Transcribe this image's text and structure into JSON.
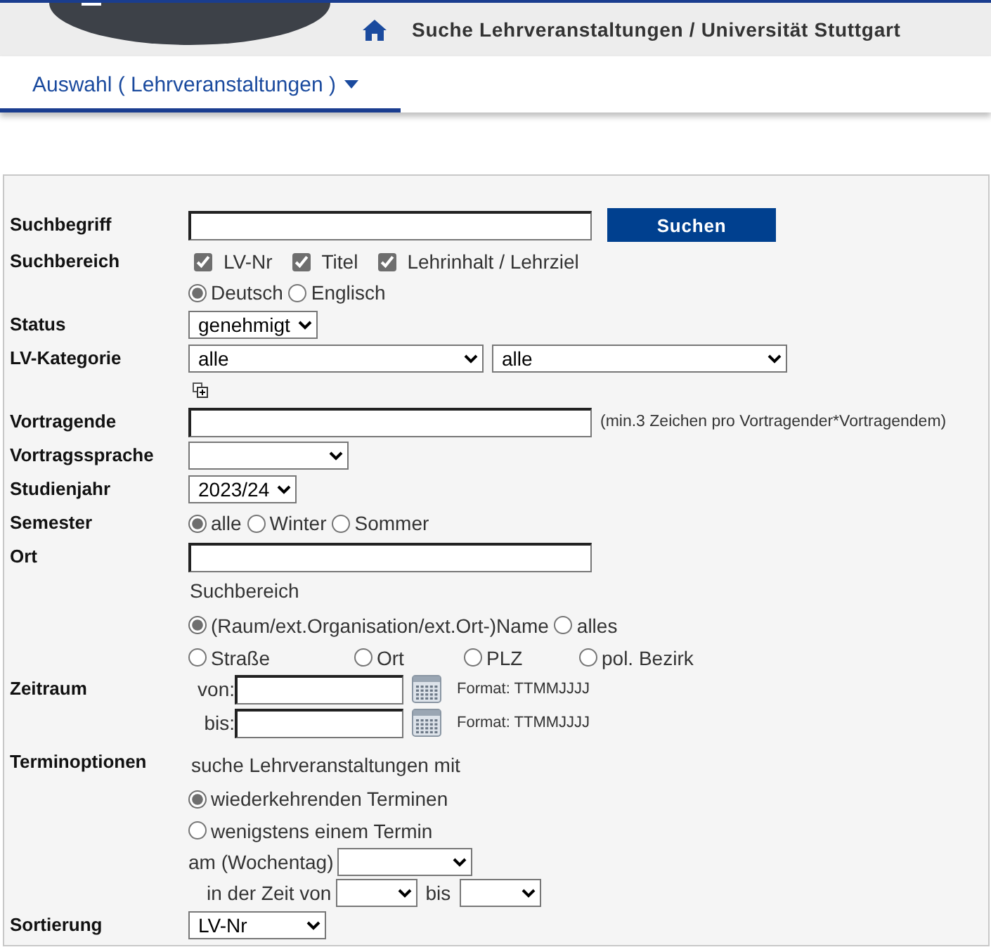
{
  "header": {
    "title": "Suche Lehrveranstaltungen / Universität Stuttgart"
  },
  "tabs": [
    {
      "label": "Auswahl ( Lehrveranstaltungen )",
      "selected": true
    }
  ],
  "form": [
    {
      "kind": "text",
      "label": "Suchbegriff",
      "button": "Suchen"
    },
    {
      "kind": "checks",
      "label": "Suchbereich",
      "checks": [
        {
          "label": "LV-Nr",
          "checked": true
        },
        {
          "label": "Titel",
          "checked": true
        },
        {
          "label": "Lehrinhalt / Lehrziel",
          "checked": true
        }
      ],
      "options": [
        {
          "label": "Deutsch",
          "selected": true
        },
        {
          "label": "Englisch",
          "selected": false
        }
      ]
    },
    {
      "kind": "select",
      "label": "Status",
      "value": "genehmigt"
    },
    {
      "kind": "selects",
      "label": "LV-Kategorie",
      "values": [
        "alle",
        "alle"
      ]
    },
    {
      "kind": "text",
      "label": "Vortragende",
      "hint": "(min.3 Zeichen pro Vortragender*Vortragendem)"
    },
    {
      "kind": "select",
      "label": "Vortragssprache"
    },
    {
      "kind": "select",
      "label": "Studienjahr",
      "value": "2023/24"
    },
    {
      "kind": "radios",
      "label": "Semester",
      "options": [
        {
          "label": "alle",
          "selected": true
        },
        {
          "label": "Winter",
          "selected": false
        },
        {
          "label": "Sommer",
          "selected": false
        }
      ]
    },
    {
      "kind": "location",
      "label": "Ort",
      "caption": "Suchbereich",
      "options": [
        {
          "label": "(Raum/ext.Organisation/ext.Ort-)Name",
          "selected": true
        },
        {
          "label": "alles",
          "selected": false
        },
        {
          "label": "Straße",
          "selected": false
        },
        {
          "label": "Ort",
          "selected": false
        },
        {
          "label": "PLZ",
          "selected": false
        },
        {
          "label": "pol. Bezirk",
          "selected": false
        }
      ]
    },
    {
      "kind": "dates",
      "label": "Zeitraum",
      "dates": [
        {
          "label": "von:",
          "format": "Format: TTMMJJJJ"
        },
        {
          "label": "bis:",
          "format": "Format: TTMMJJJJ"
        }
      ]
    },
    {
      "kind": "schedule",
      "label": "Terminoptionen",
      "caption": "suche Lehrveranstaltungen mit",
      "options": [
        {
          "label": "wiederkehrenden Terminen",
          "selected": true
        },
        {
          "label": "wenigstens einem Termin",
          "selected": false
        }
      ],
      "weekday_label": "am (Wochentag)",
      "time_label": "in der Zeit von",
      "time_to": "bis"
    },
    {
      "kind": "select",
      "label": "Sortierung",
      "value": "LV-Nr"
    }
  ]
}
